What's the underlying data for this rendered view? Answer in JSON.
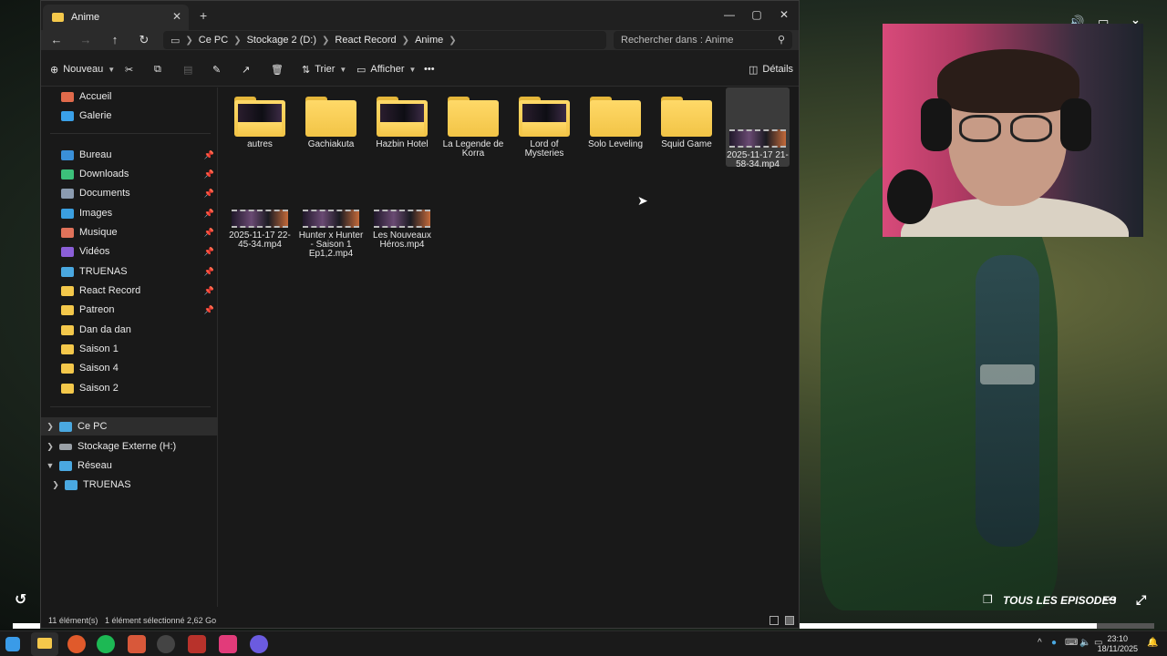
{
  "window": {
    "tab_title": "Anime",
    "new_tab": "+",
    "minimize": "—",
    "maximize": "▢",
    "close": "✕"
  },
  "nav_buttons": {
    "back": "←",
    "forward": "→",
    "up": "↑",
    "refresh": "↻"
  },
  "breadcrumb": [
    "Ce PC",
    "Stockage 2 (D:)",
    "React Record",
    "Anime"
  ],
  "search": {
    "placeholder": "Rechercher dans : Anime"
  },
  "toolbar": {
    "new_label": "Nouveau",
    "sort_label": "Trier",
    "view_label": "Afficher",
    "more": "•••",
    "details_label": "Détails"
  },
  "sidebar": {
    "top": [
      {
        "label": "Accueil",
        "icon": "home-icon"
      },
      {
        "label": "Galerie",
        "icon": "gallery-icon"
      }
    ],
    "quick_access": [
      {
        "label": "Bureau",
        "icon": "desktop-icon",
        "pinned": true
      },
      {
        "label": "Downloads",
        "icon": "download-icon",
        "pinned": true
      },
      {
        "label": "Documents",
        "icon": "documents-icon",
        "pinned": true
      },
      {
        "label": "Images",
        "icon": "images-icon",
        "pinned": true
      },
      {
        "label": "Musique",
        "icon": "music-icon",
        "pinned": true
      },
      {
        "label": "Vidéos",
        "icon": "videos-icon",
        "pinned": true
      },
      {
        "label": "TRUENAS",
        "icon": "pc-icon",
        "pinned": true
      },
      {
        "label": "React Record",
        "icon": "folder-icon",
        "pinned": true
      },
      {
        "label": "Patreon",
        "icon": "folder-icon",
        "pinned": true
      },
      {
        "label": "Dan da dan",
        "icon": "folder-icon",
        "pinned": false
      },
      {
        "label": "Saison 1",
        "icon": "folder-icon",
        "pinned": false
      },
      {
        "label": "Saison 4",
        "icon": "folder-icon",
        "pinned": false
      },
      {
        "label": "Saison 2",
        "icon": "folder-icon",
        "pinned": false
      }
    ],
    "tree": [
      {
        "label": "Ce PC",
        "icon": "pc-icon",
        "expanded": false,
        "selected": true
      },
      {
        "label": "Stockage Externe (H:)",
        "icon": "drive-icon",
        "expanded": false
      },
      {
        "label": "Réseau",
        "icon": "network-icon",
        "expanded": true
      },
      {
        "label": "TRUENAS",
        "icon": "pc-icon",
        "expanded": false
      }
    ]
  },
  "files": [
    {
      "name": "autres",
      "type": "folder",
      "preview": true
    },
    {
      "name": "Gachiakuta",
      "type": "folder",
      "preview": false
    },
    {
      "name": "Hazbin Hotel",
      "type": "folder",
      "preview": true
    },
    {
      "name": "La Legende de Korra",
      "type": "folder",
      "preview": false
    },
    {
      "name": "Lord of Mysteries",
      "type": "folder",
      "preview": true
    },
    {
      "name": "Solo Leveling",
      "type": "folder",
      "preview": false
    },
    {
      "name": "Squid Game",
      "type": "folder",
      "preview": false
    },
    {
      "name": "2025-11-17 21-58-34.mp4",
      "type": "video",
      "selected": true
    },
    {
      "name": "2025-11-17 22-45-34.mp4",
      "type": "video"
    },
    {
      "name": "Hunter x Hunter - Saison 1 Ep1,2.mp4",
      "type": "video"
    },
    {
      "name": "Les Nouveaux Héros.mp4",
      "type": "video"
    }
  ],
  "status": {
    "count": "11 élément(s)",
    "selection": "1 élément sélectionné  2,62 Go"
  },
  "video_player": {
    "episodes_label": "TOUS LES EPISODES",
    "progress": 0.95
  },
  "taskbar": {
    "time": "23:10",
    "date": "18/11/2025"
  },
  "colors": {
    "folder": "#f4c84b",
    "accent": "#4aa8e0",
    "window_bg": "#191919"
  }
}
